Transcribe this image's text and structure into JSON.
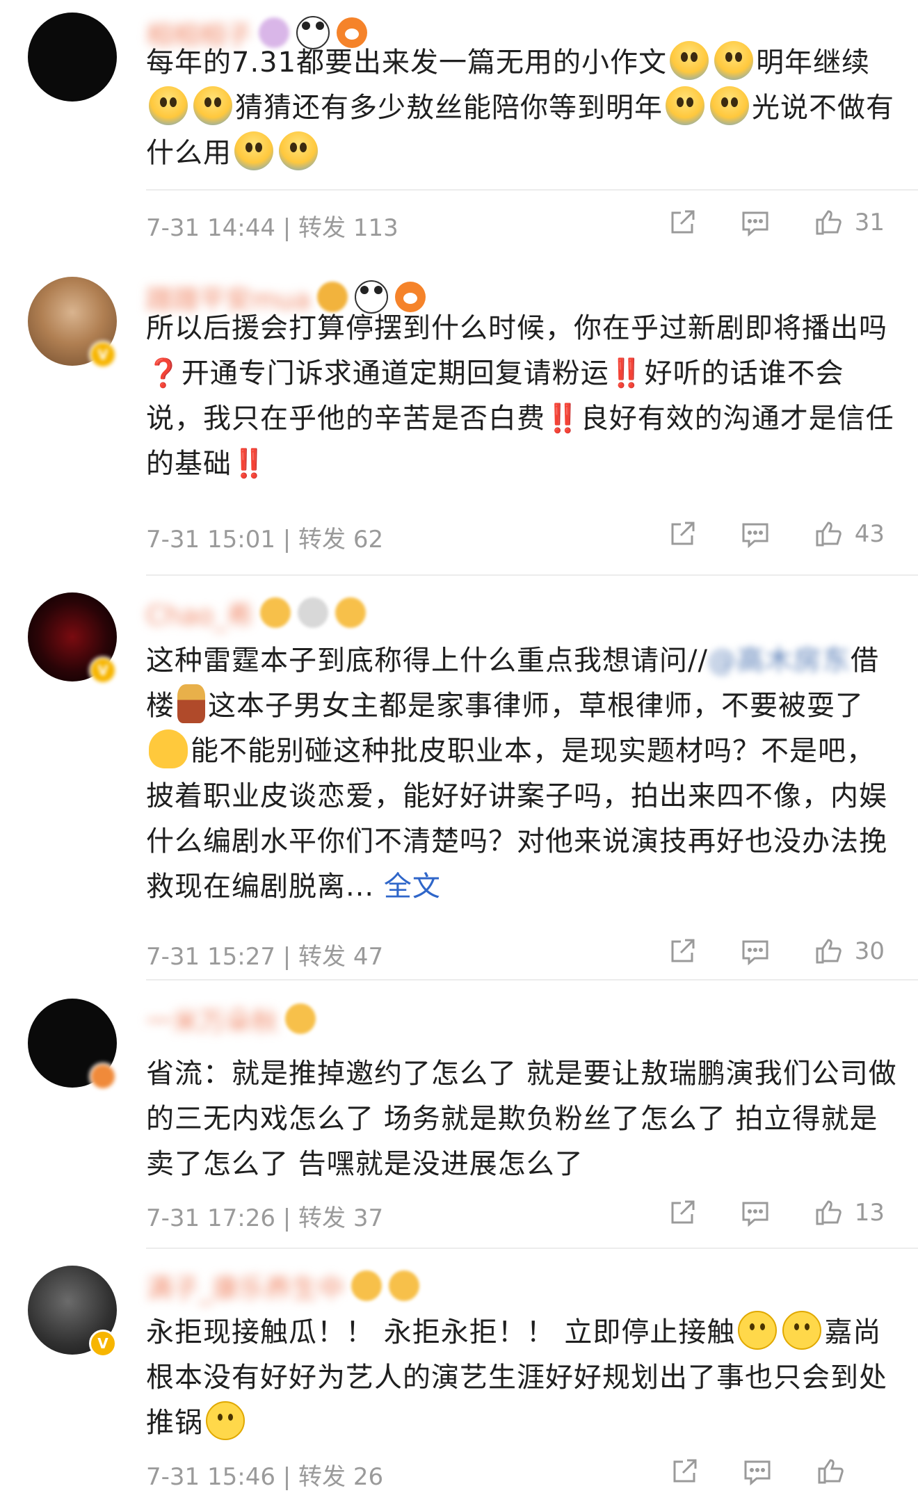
{
  "comments": [
    {
      "username": "相相相子",
      "text_parts": {
        "a": "每年的7.31都要出来发一篇无用的小作文",
        "b": "明年继续",
        "c": "猜猜还有多少敖丝能陪你等到明年",
        "d": "光说不做有什么用"
      },
      "time": "7-31 14:44",
      "repost_label": "转发",
      "repost_count": "113",
      "like_count": "31"
    },
    {
      "username": "蹭蹭平安mua",
      "text_parts": {
        "a": "所以后援会打算停摆到什么时候，你在乎过新剧即将播出吗",
        "b": "❓",
        "c": "开通专门诉求通道定期回复请粉运",
        "d": "‼️",
        "e": "好听的话谁不会说，我只在乎他的辛苦是否白费",
        "f": "‼️",
        "g": "良好有效的沟通才是信任的基础",
        "h": "‼️"
      },
      "time": "7-31 15:01",
      "repost_label": "转发",
      "repost_count": "62",
      "like_count": "43"
    },
    {
      "username": "Chao_希",
      "text_parts": {
        "a": "这种雷霆本子到底称得上什么重点我想请问//",
        "mention": "@高木房东",
        "b": "借楼",
        "c": "这本子男女主都是家事律师，草根律师，不要被耍了",
        "d": "能不能别碰这种批皮职业本，是现实题材吗？不是吧，披着职业皮谈恋爱，能好好讲案子吗，拍出来四不像，内娱什么编剧水平你们不清楚吗？对他来说演技再好也没办法挽救现在编剧脱离...",
        "more": "全文"
      },
      "time": "7-31 15:27",
      "repost_label": "转发",
      "repost_count": "47",
      "like_count": "30"
    },
    {
      "username": "一米万朵秋",
      "text_parts": {
        "a": "省流：就是推掉邀约了怎么了 就是要让敖瑞鹏演我们公司做的三无内戏怎么了 场务就是欺负粉丝了怎么了 拍立得就是卖了怎么了 告嘿就是没进展怎么了"
      },
      "time": "7-31 17:26",
      "repost_label": "转发",
      "repost_count": "37",
      "like_count": "13"
    },
    {
      "username": "满子_康乐养生中",
      "text_parts": {
        "a": "永拒现接触瓜！！ 永拒永拒！！ 立即停止接触",
        "b": "嘉尚根本没有好好为艺人的演艺生涯好好规划出了事也只会到处推锅"
      },
      "time": "7-31 15:46",
      "repost_label": "转发",
      "repost_count": "26",
      "like_count": ""
    }
  ],
  "icons": [
    "share-icon",
    "comment-icon",
    "thumbs-up-icon",
    "panda-emoji",
    "fox-emoji",
    "shocked-emoji",
    "smile-emoji"
  ],
  "colors": {
    "meta": "#9a9a9a",
    "link": "#2f66c9",
    "alert": "#e3201b",
    "divider": "#ececec"
  }
}
